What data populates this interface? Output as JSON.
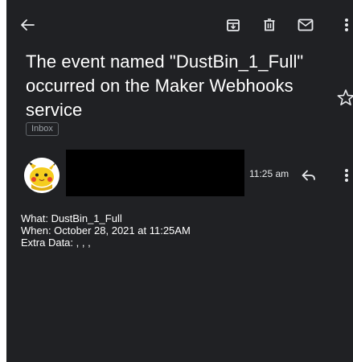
{
  "email": {
    "subject": "The event named \"DustBin_1_Full\" occurred on the Maker Webhooks service",
    "label": "Inbox",
    "time": "11:25 am",
    "body": {
      "what": "What: DustBin_1_Full",
      "when": "When: October 28, 2021 at 11:25AM",
      "extra": "Extra Data: , , ,"
    }
  },
  "icons": {
    "back": "arrow-left-icon",
    "archive": "archive-icon",
    "delete": "trash-icon",
    "mark_unread": "mail-icon",
    "more": "more-vertical-icon",
    "star": "star-outline-icon",
    "reply": "reply-icon",
    "message_more": "more-vertical-icon"
  },
  "colors": {
    "background": "#202124",
    "text": "#ffffff",
    "muted": "#9aa0a6",
    "redaction": "#000000"
  }
}
